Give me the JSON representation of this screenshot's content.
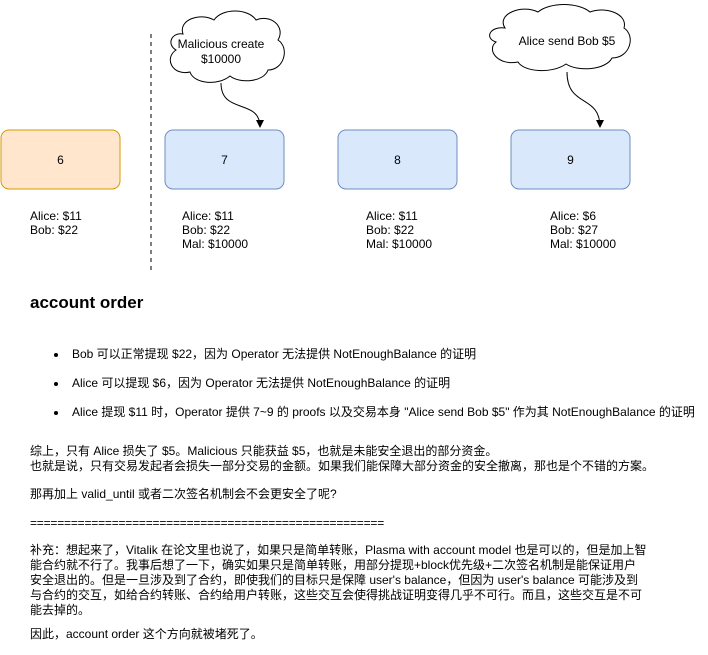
{
  "blocks": [
    {
      "label": "6",
      "fill": "#ffe6cc",
      "stroke": "#d79b00",
      "balances": [
        "Alice: $11",
        "Bob: $22"
      ]
    },
    {
      "label": "7",
      "fill": "#dae8fc",
      "stroke": "#6c8ebf",
      "balances": [
        "Alice: $11",
        "Bob: $22",
        "Mal: $10000"
      ]
    },
    {
      "label": "8",
      "fill": "#dae8fc",
      "stroke": "#6c8ebf",
      "balances": [
        "Alice: $11",
        "Bob: $22",
        "Mal: $10000"
      ]
    },
    {
      "label": "9",
      "fill": "#dae8fc",
      "stroke": "#6c8ebf",
      "balances": [
        "Alice: $6",
        "Bob: $27",
        "Mal: $10000"
      ]
    }
  ],
  "clouds": [
    {
      "lines": [
        "Malicious create",
        "$10000"
      ]
    },
    {
      "lines": [
        "Alice send Bob $5"
      ]
    }
  ],
  "heading": "account order",
  "bullets": [
    "Bob 可以正常提现 $22，因为 Operator 无法提供 NotEnoughBalance 的证明",
    "Alice 可以提现 $6，因为 Operator 无法提供 NotEnoughBalance 的证明",
    "Alice 提现 $11 时，Operator 提供 7~9 的 proofs 以及交易本身 \"Alice send Bob $5\" 作为其 NotEnoughBalance 的证明"
  ],
  "summary": [
    "综上，只有 Alice 损失了 $5。Malicious 只能获益 $5，也就是未能安全退出的部分资金。",
    "也就是说，只有交易发起者会损失一部分交易的金额。如果我们能保障大部分资金的安全撤离，那也是个不错的方案。"
  ],
  "question": "那再加上 valid_until 或者二次签名机制会不会更安全了呢?",
  "separator": "====================================================",
  "addendum": [
    "补充：想起来了，Vitalik 在论文里也说了，如果只是简单转账，Plasma with account model 也是可以的，但是加上智",
    "能合约就不行了。我事后想了一下，确实如果只是简单转账，用部分提现+block优先级+二次签名机制是能保证用户",
    "安全退出的。但是一旦涉及到了合约，即使我们的目标只是保障 user's balance，但因为 user's balance 可能涉及到",
    "与合约的交互，如给合约转账、合约给用户转账，这些交互会使得挑战证明变得几乎不可行。而且，这些交互是不可",
    "能去掉的。"
  ],
  "conclusion": "因此，account order 这个方向就被堵死了。"
}
